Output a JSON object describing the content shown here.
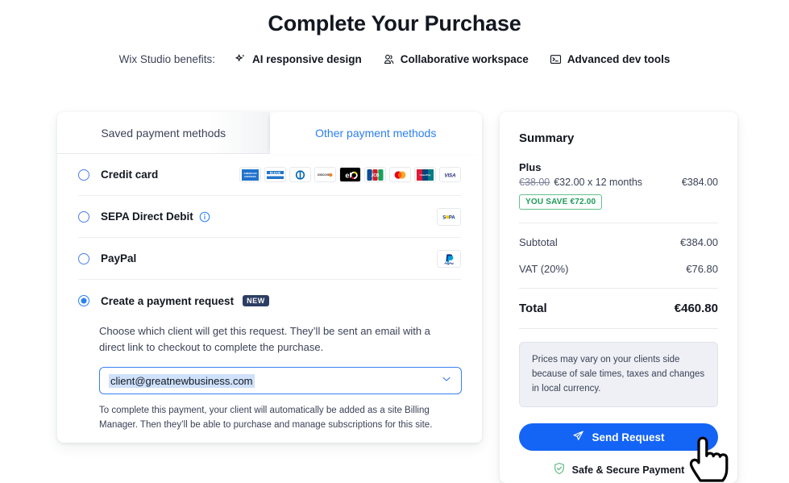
{
  "header": {
    "title": "Complete Your Purchase",
    "benefits_label": "Wix Studio benefits:",
    "benefits": [
      {
        "icon": "sparkle-icon",
        "label": "AI responsive design"
      },
      {
        "icon": "people-icon",
        "label": "Collaborative workspace"
      },
      {
        "icon": "terminal-icon",
        "label": "Advanced dev tools"
      }
    ]
  },
  "payment": {
    "tabs": [
      {
        "label": "Saved payment methods",
        "active": false
      },
      {
        "label": "Other payment methods",
        "active": true
      }
    ],
    "methods": [
      {
        "id": "credit-card",
        "label": "Credit card",
        "selected": false,
        "logos": [
          "amex",
          "carte-bleue",
          "diners-club",
          "discover",
          "elo",
          "jcb",
          "mastercard",
          "unionpay",
          "visa"
        ]
      },
      {
        "id": "sepa-direct-debit",
        "label": "SEPA Direct Debit",
        "selected": false,
        "has_info": true,
        "logos": [
          "sepa"
        ]
      },
      {
        "id": "paypal",
        "label": "PayPal",
        "selected": false,
        "logos": [
          "paypal"
        ]
      },
      {
        "id": "payment-request",
        "label": "Create a payment request",
        "selected": true,
        "badge": "NEW",
        "logos": []
      }
    ],
    "request": {
      "description": "Choose which client will get this request. They’ll be sent an email with a direct link to checkout to complete the purchase.",
      "selected_client": "client@greatnewbusiness.com",
      "note": "To complete this payment, your client will automatically be added as a site Billing Manager. Then they’ll be able to purchase and manage subscriptions for this site."
    }
  },
  "summary": {
    "title": "Summary",
    "plan_name": "Plus",
    "old_price": "€38.00",
    "price_line": "€32.00 x 12 months",
    "plan_total": "€384.00",
    "save_badge": "YOU SAVE €72.00",
    "rows": [
      {
        "label": "Subtotal",
        "value": "€384.00"
      },
      {
        "label": "VAT (20%)",
        "value": "€76.80"
      }
    ],
    "total_label": "Total",
    "total_value": "€460.80",
    "notice": "Prices may vary on your clients side because of sale times, taxes and changes in local currency.",
    "send_label": "Send Request",
    "secure_label": "Safe & Secure Payment"
  },
  "colors": {
    "accent_blue": "#1464f6",
    "tab_active_text": "#2b7ff5",
    "save_green": "#1f9a59",
    "badge_navy": "#2c3e63",
    "text_dark": "#131720"
  }
}
